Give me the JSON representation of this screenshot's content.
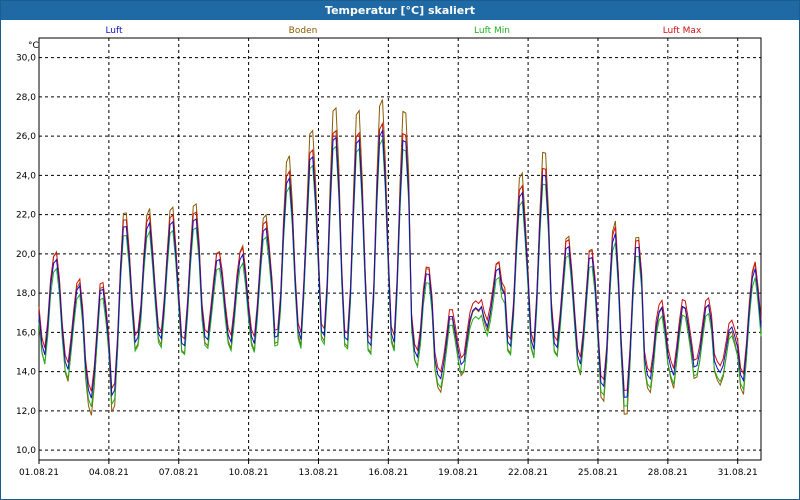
{
  "window": {
    "title": "Temperatur [°C] skaliert"
  },
  "chart_data": {
    "type": "line",
    "title": "Temperatur [°C] skaliert",
    "ylabel": "°C",
    "ylim": [
      9.5,
      31.0
    ],
    "grid": true,
    "y_ticks": [
      "10,0",
      "12,0",
      "14,0",
      "16,0",
      "18,0",
      "20,0",
      "22,0",
      "24,0",
      "26,0",
      "28,0",
      "30,0"
    ],
    "x_ticks": [
      "01.08.21",
      "04.08.21",
      "07.08.21",
      "10.08.21",
      "13.08.21",
      "16.08.21",
      "19.08.21",
      "22.08.21",
      "25.08.21",
      "28.08.21",
      "31.08.21"
    ],
    "xlim": [
      "01.08.21",
      "01.09.21"
    ],
    "legend_position": "top",
    "daily": [
      {
        "date": "01.08.21",
        "min": 15.0,
        "max": 20.2
      },
      {
        "date": "02.08.21",
        "min": 14.6,
        "max": 18.8
      },
      {
        "date": "03.08.21",
        "min": 12.8,
        "max": 17.5
      },
      {
        "date": "04.08.21",
        "min": 12.0,
        "max": 21.8
      },
      {
        "date": "05.08.21",
        "min": 15.3,
        "max": 21.5
      },
      {
        "date": "06.08.21",
        "min": 15.7,
        "max": 21.8
      },
      {
        "date": "07.08.21",
        "min": 15.2,
        "max": 22.3
      },
      {
        "date": "08.08.21",
        "min": 15.5,
        "max": 20.0
      },
      {
        "date": "09.08.21",
        "min": 15.6,
        "max": 19.8
      },
      {
        "date": "10.08.21",
        "min": 15.3,
        "max": 21.0
      },
      {
        "date": "11.08.21",
        "min": 15.4,
        "max": 23.8
      },
      {
        "date": "12.08.21",
        "min": 15.5,
        "max": 24.8
      },
      {
        "date": "13.08.21",
        "min": 15.7,
        "max": 26.5
      },
      {
        "date": "14.08.21",
        "min": 15.3,
        "max": 26.0
      },
      {
        "date": "15.08.21",
        "min": 15.1,
        "max": 26.2
      },
      {
        "date": "16.08.21",
        "min": 15.1,
        "max": 28.0
      },
      {
        "date": "17.08.21",
        "min": 15.2,
        "max": 19.8
      },
      {
        "date": "18.08.21",
        "min": 13.5,
        "max": 16.8
      },
      {
        "date": "19.08.21",
        "min": 13.8,
        "max": 17.0
      },
      {
        "date": "20.08.21",
        "min": 16.6,
        "max": 18.4
      },
      {
        "date": "21.08.21",
        "min": 15.1,
        "max": 22.8
      },
      {
        "date": "22.08.21",
        "min": 15.0,
        "max": 25.2
      },
      {
        "date": "23.08.21",
        "min": 15.4,
        "max": 20.5
      },
      {
        "date": "24.08.21",
        "min": 14.8,
        "max": 19.8
      },
      {
        "date": "25.08.21",
        "min": 13.2,
        "max": 21.0
      },
      {
        "date": "26.08.21",
        "min": 12.2,
        "max": 21.5
      },
      {
        "date": "27.08.21",
        "min": 13.5,
        "max": 17.5
      },
      {
        "date": "28.08.21",
        "min": 13.8,
        "max": 17.2
      },
      {
        "date": "29.08.21",
        "min": 14.2,
        "max": 17.8
      },
      {
        "date": "30.08.21",
        "min": 14.0,
        "max": 15.8
      },
      {
        "date": "31.08.21",
        "min": 13.2,
        "max": 19.0
      },
      {
        "date": "01.09.21",
        "min": 14.5,
        "max": 20.0
      }
    ],
    "series": [
      {
        "name": "Luft",
        "color": "#1010c8",
        "role": "mean"
      },
      {
        "name": "Boden",
        "color": "#8b5a00",
        "role": "soil"
      },
      {
        "name": "Luft Min",
        "color": "#20b020",
        "role": "min"
      },
      {
        "name": "Luft Max",
        "color": "#d01010",
        "role": "max"
      }
    ]
  }
}
